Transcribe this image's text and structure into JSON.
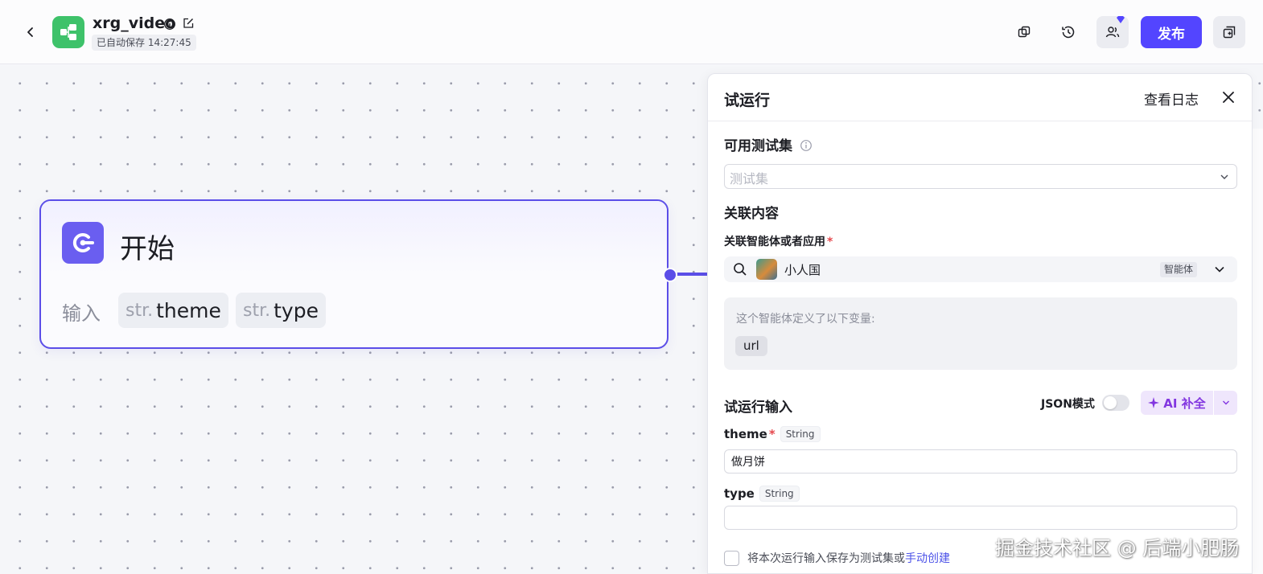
{
  "topbar": {
    "app_name": "xrg_video",
    "save_status": "已自动保存 14:27:45",
    "publish_label": "发布"
  },
  "canvas": {
    "start_node": {
      "title": "开始",
      "input_label": "输入",
      "params": [
        {
          "type": "str.",
          "name": "theme"
        },
        {
          "type": "str.",
          "name": "type"
        }
      ]
    }
  },
  "panel": {
    "title": "试运行",
    "log_link": "查看日志",
    "testset": {
      "label": "可用测试集",
      "placeholder": "测试集"
    },
    "related": {
      "label": "关联内容",
      "sub_label": "关联智能体或者应用",
      "agent_name": "小人国",
      "agent_tag": "智能体",
      "var_note": "这个智能体定义了以下变量:",
      "variables": [
        "url"
      ]
    },
    "run_input": {
      "label": "试运行输入",
      "json_mode_label": "JSON模式",
      "ai_button_label": "AI 补全",
      "fields": [
        {
          "name": "theme",
          "type": "String",
          "required": "*",
          "value": ""
        },
        {
          "name": "type",
          "type": "String",
          "value": ""
        }
      ],
      "theme_value": "做月饼",
      "type_value": ""
    },
    "save": {
      "text": "将本次运行输入保存为测试集或",
      "link": "手动创建"
    }
  },
  "watermark": "掘金技术社区 @ 后端小肥肠",
  "colors": {
    "accent": "#5345ff",
    "node_border": "#5b4ee8",
    "app_logo": "#3ec26a",
    "ai_purple": "#8236e0"
  }
}
